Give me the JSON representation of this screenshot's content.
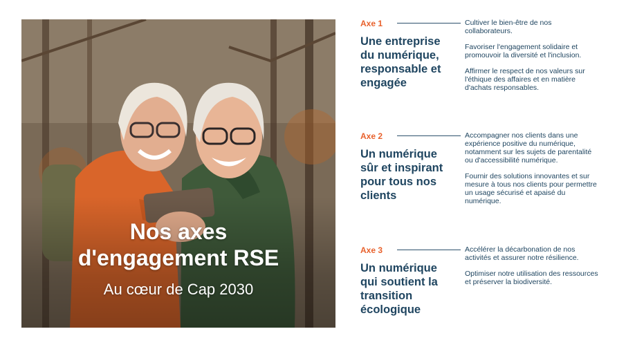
{
  "photo": {
    "title_line1": "Nos axes",
    "title_line2": "d'engagement RSE",
    "subtitle": "Au cœur de Cap 2030"
  },
  "axes": [
    {
      "label": "Axe 1",
      "heading": "Une entreprise du numérique, responsable et engagée",
      "items": [
        "Cultiver le bien-être de nos collaborateurs.",
        "Favoriser l'engagement solidaire et promouvoir la diversité et l'inclusion.",
        "Affirmer le respect de nos valeurs sur l'éthique des affaires et en matière d'achats responsables."
      ]
    },
    {
      "label": "Axe 2",
      "heading": "Un numérique sûr et inspirant pour tous nos clients",
      "items": [
        "Accompagner nos clients dans une expérience positive du numérique, notamment sur les sujets de parentalité ou d'accessibilité numérique.",
        "Fournir des solutions innovantes et sur mesure à tous nos clients pour permettre un usage sécurisé et apaisé du numérique."
      ]
    },
    {
      "label": "Axe 3",
      "heading": "Un numérique qui soutient la transition écologique",
      "items": [
        "Accélérer la décarbonation de nos activités et assurer notre résilience.",
        "Optimiser notre utilisation des ressources et préserver la biodiversité."
      ]
    }
  ],
  "colors": {
    "accent": "#e8612c",
    "text": "#1f4560"
  }
}
